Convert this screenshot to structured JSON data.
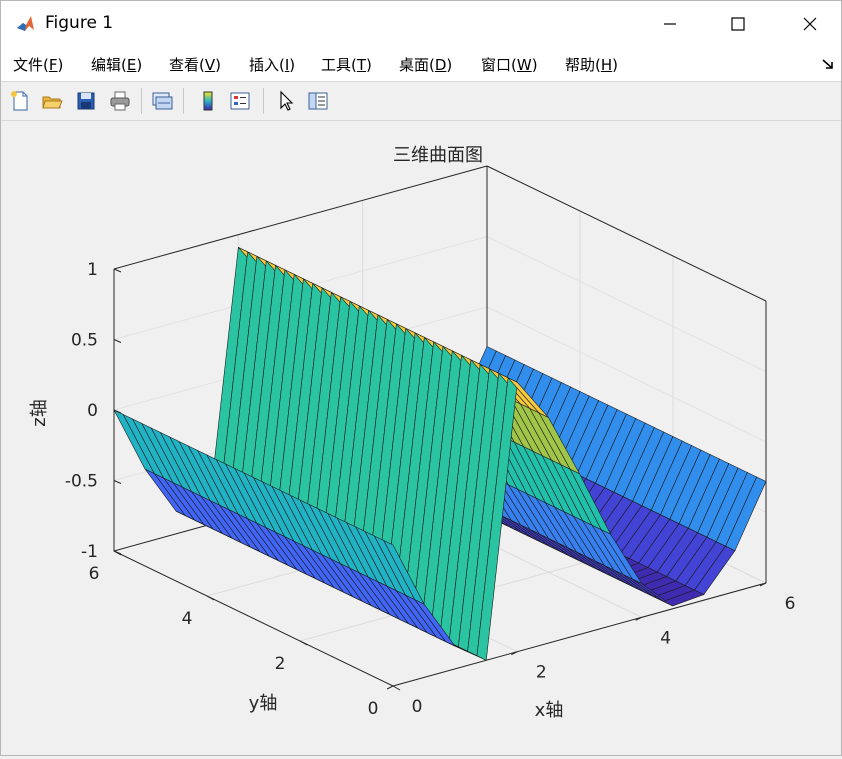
{
  "window": {
    "title": "Figure 1"
  },
  "menu": [
    {
      "label": "文件(",
      "key": "F",
      "suffix": ")"
    },
    {
      "label": "编辑(",
      "key": "E",
      "suffix": ")"
    },
    {
      "label": "查看(",
      "key": "V",
      "suffix": ")"
    },
    {
      "label": "插入(",
      "key": "I",
      "suffix": ")"
    },
    {
      "label": "工具(",
      "key": "T",
      "suffix": ")"
    },
    {
      "label": "桌面(",
      "key": "D",
      "suffix": ")"
    },
    {
      "label": "窗口(",
      "key": "W",
      "suffix": ")"
    },
    {
      "label": "帮助(",
      "key": "H",
      "suffix": ")"
    }
  ],
  "toolbar": [
    "new-figure-icon",
    "open-file-icon",
    "save-icon",
    "print-icon",
    "link-plot-icon",
    "colorbar-icon",
    "legend-icon",
    "pointer-icon",
    "property-inspector-icon"
  ],
  "chart_data": {
    "type": "surface",
    "title": "三维曲面图",
    "xlabel": "x轴",
    "ylabel": "y轴",
    "zlabel": "z轴",
    "xlim": [
      0,
      6
    ],
    "ylim": [
      0,
      6
    ],
    "zlim": [
      -1,
      1
    ],
    "xticks": [
      "0",
      "2",
      "4",
      "6"
    ],
    "yticks": [
      "0",
      "2",
      "4",
      "6"
    ],
    "zticks": [
      "-1",
      "-0.5",
      "0",
      "0.5",
      "1"
    ],
    "x": [
      0,
      0.5,
      1,
      1.5,
      2,
      2.5,
      3,
      3.5,
      4,
      4.5,
      5,
      5.5,
      6
    ],
    "z_profile": [
      0,
      -0.48,
      -0.84,
      -1.0,
      0.91,
      0.6,
      0.14,
      -0.35,
      -0.76,
      -0.98,
      -0.96,
      -0.71,
      -0.28
    ],
    "colormap": [
      "#3e26a8",
      "#4658f8",
      "#2c9fe8",
      "#1bbdb1",
      "#4bd184",
      "#b7c23a",
      "#f5c340",
      "#f9e51e"
    ],
    "grid": true
  }
}
